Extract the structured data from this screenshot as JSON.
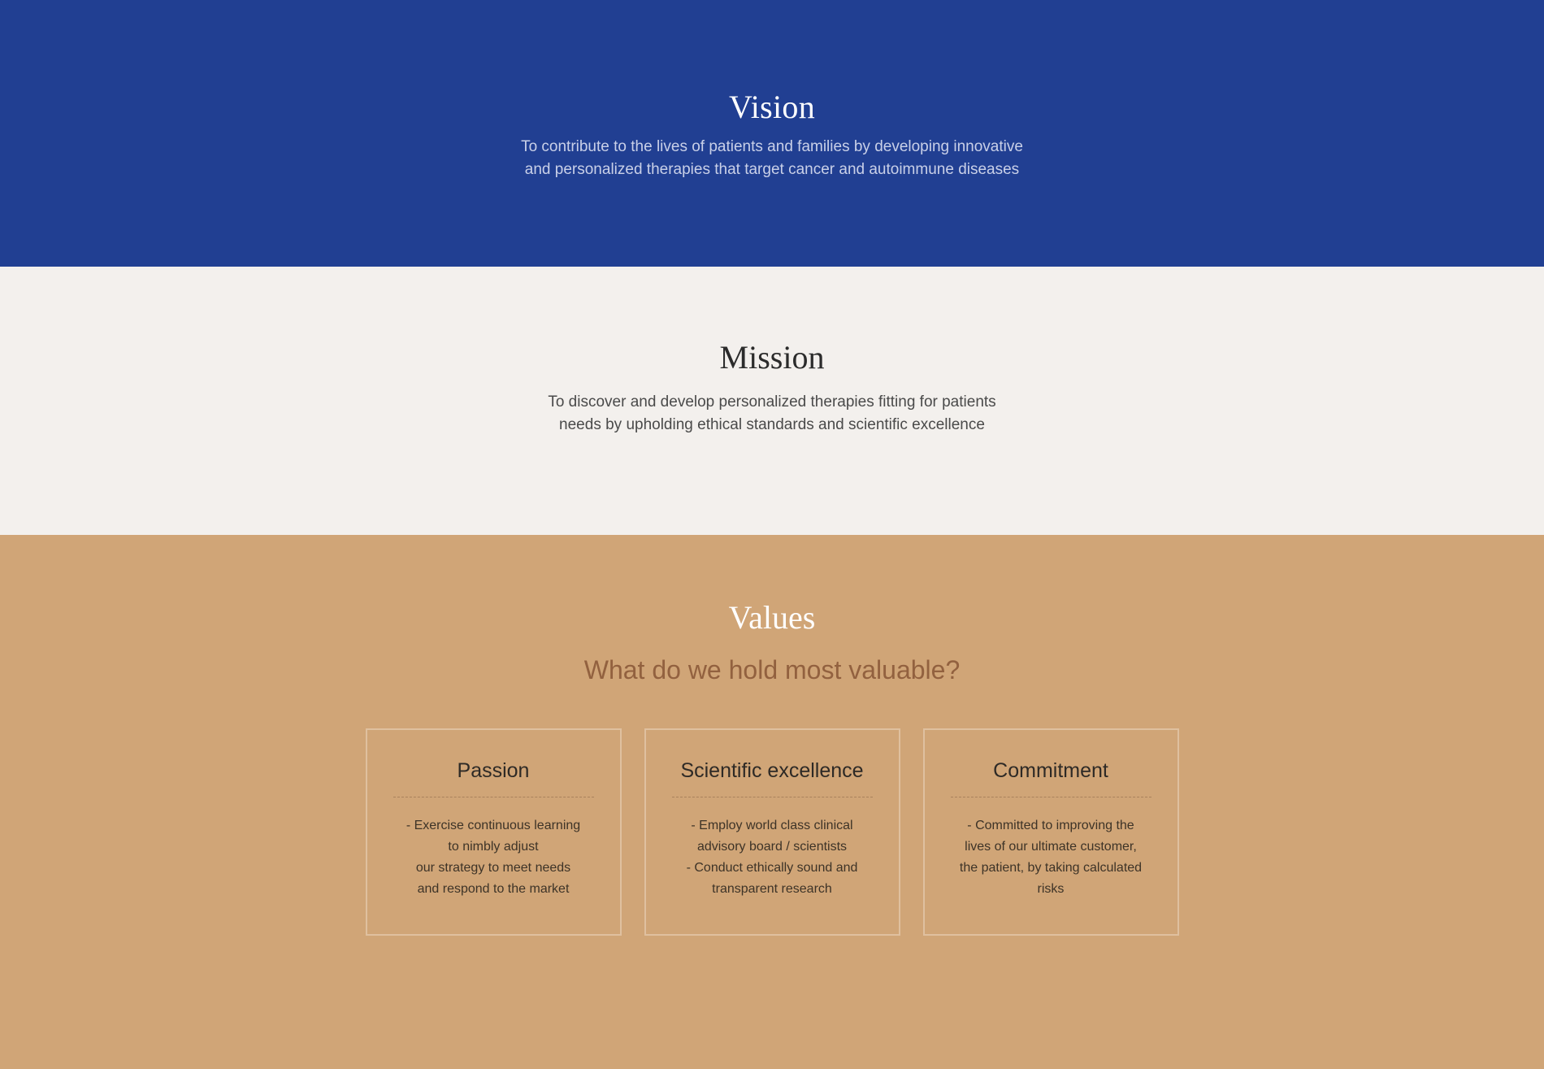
{
  "vision": {
    "title": "Vision",
    "text": "To contribute to the lives of patients and families by developing innovative and personalized therapies that target cancer and autoimmune diseases"
  },
  "mission": {
    "title": "Mission",
    "text": "To discover and develop personalized therapies fitting for patients needs by upholding ethical standards and scientific excellence"
  },
  "values": {
    "title": "Values",
    "subtitle": "What do we hold most valuable?",
    "cards": [
      {
        "title": "Passion",
        "text": "- Exercise continuous learning\nto nimbly adjust\nour strategy to meet needs\nand respond to the market"
      },
      {
        "title": "Scientific excellence",
        "text": "- Employ world class clinical\nadvisory board / scientists\n- Conduct ethically sound and\ntransparent research"
      },
      {
        "title": "Commitment",
        "text": "- Committed to improving the\nlives of our ultimate customer,\nthe patient, by taking calculated\nrisks"
      }
    ]
  },
  "colors": {
    "vision_bg": "#213f92",
    "mission_bg": "#f3f0ed",
    "values_bg": "#d0a577",
    "subtitle": "#92613f"
  }
}
